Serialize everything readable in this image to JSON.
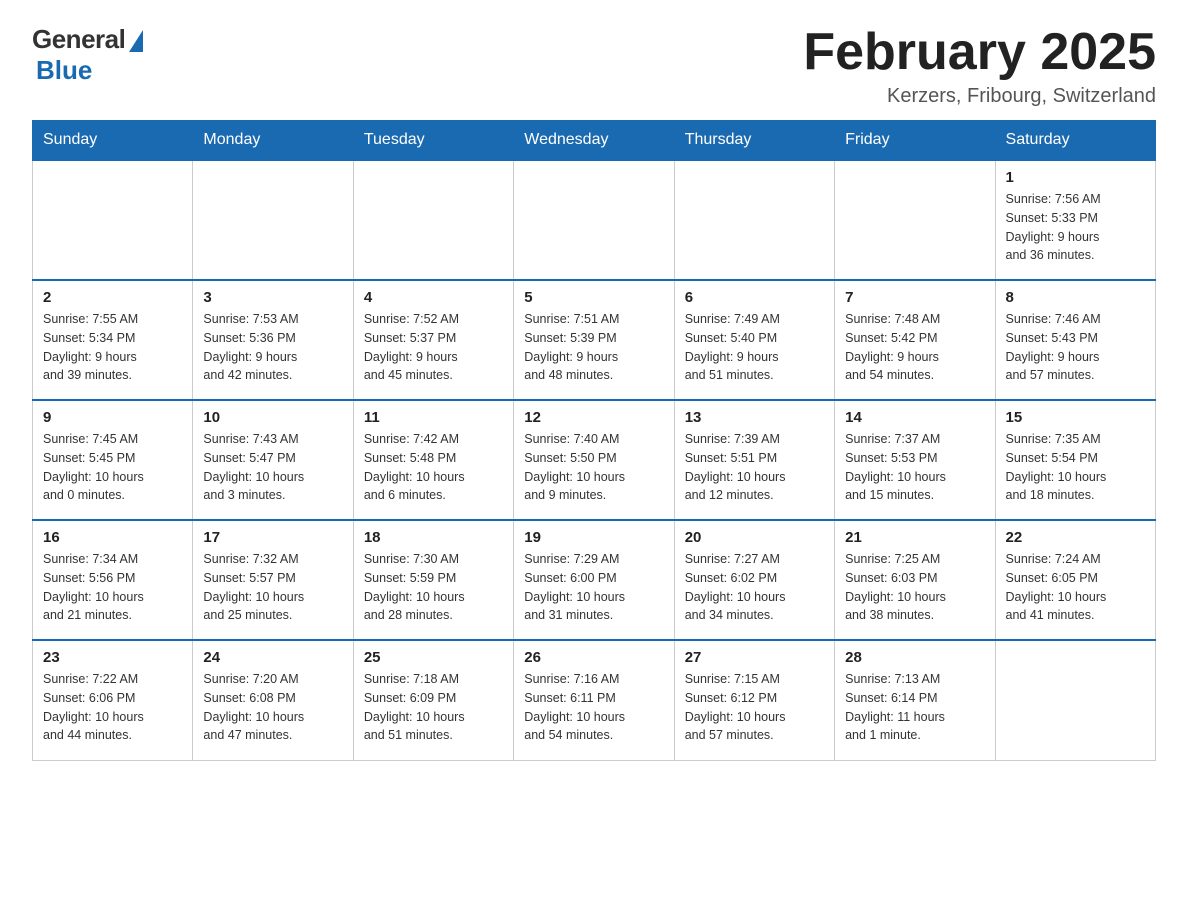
{
  "logo": {
    "general": "General",
    "blue": "Blue"
  },
  "header": {
    "month_title": "February 2025",
    "location": "Kerzers, Fribourg, Switzerland"
  },
  "weekdays": [
    "Sunday",
    "Monday",
    "Tuesday",
    "Wednesday",
    "Thursday",
    "Friday",
    "Saturday"
  ],
  "weeks": [
    {
      "days": [
        {
          "date": "",
          "info": ""
        },
        {
          "date": "",
          "info": ""
        },
        {
          "date": "",
          "info": ""
        },
        {
          "date": "",
          "info": ""
        },
        {
          "date": "",
          "info": ""
        },
        {
          "date": "",
          "info": ""
        },
        {
          "date": "1",
          "info": "Sunrise: 7:56 AM\nSunset: 5:33 PM\nDaylight: 9 hours\nand 36 minutes."
        }
      ]
    },
    {
      "days": [
        {
          "date": "2",
          "info": "Sunrise: 7:55 AM\nSunset: 5:34 PM\nDaylight: 9 hours\nand 39 minutes."
        },
        {
          "date": "3",
          "info": "Sunrise: 7:53 AM\nSunset: 5:36 PM\nDaylight: 9 hours\nand 42 minutes."
        },
        {
          "date": "4",
          "info": "Sunrise: 7:52 AM\nSunset: 5:37 PM\nDaylight: 9 hours\nand 45 minutes."
        },
        {
          "date": "5",
          "info": "Sunrise: 7:51 AM\nSunset: 5:39 PM\nDaylight: 9 hours\nand 48 minutes."
        },
        {
          "date": "6",
          "info": "Sunrise: 7:49 AM\nSunset: 5:40 PM\nDaylight: 9 hours\nand 51 minutes."
        },
        {
          "date": "7",
          "info": "Sunrise: 7:48 AM\nSunset: 5:42 PM\nDaylight: 9 hours\nand 54 minutes."
        },
        {
          "date": "8",
          "info": "Sunrise: 7:46 AM\nSunset: 5:43 PM\nDaylight: 9 hours\nand 57 minutes."
        }
      ]
    },
    {
      "days": [
        {
          "date": "9",
          "info": "Sunrise: 7:45 AM\nSunset: 5:45 PM\nDaylight: 10 hours\nand 0 minutes."
        },
        {
          "date": "10",
          "info": "Sunrise: 7:43 AM\nSunset: 5:47 PM\nDaylight: 10 hours\nand 3 minutes."
        },
        {
          "date": "11",
          "info": "Sunrise: 7:42 AM\nSunset: 5:48 PM\nDaylight: 10 hours\nand 6 minutes."
        },
        {
          "date": "12",
          "info": "Sunrise: 7:40 AM\nSunset: 5:50 PM\nDaylight: 10 hours\nand 9 minutes."
        },
        {
          "date": "13",
          "info": "Sunrise: 7:39 AM\nSunset: 5:51 PM\nDaylight: 10 hours\nand 12 minutes."
        },
        {
          "date": "14",
          "info": "Sunrise: 7:37 AM\nSunset: 5:53 PM\nDaylight: 10 hours\nand 15 minutes."
        },
        {
          "date": "15",
          "info": "Sunrise: 7:35 AM\nSunset: 5:54 PM\nDaylight: 10 hours\nand 18 minutes."
        }
      ]
    },
    {
      "days": [
        {
          "date": "16",
          "info": "Sunrise: 7:34 AM\nSunset: 5:56 PM\nDaylight: 10 hours\nand 21 minutes."
        },
        {
          "date": "17",
          "info": "Sunrise: 7:32 AM\nSunset: 5:57 PM\nDaylight: 10 hours\nand 25 minutes."
        },
        {
          "date": "18",
          "info": "Sunrise: 7:30 AM\nSunset: 5:59 PM\nDaylight: 10 hours\nand 28 minutes."
        },
        {
          "date": "19",
          "info": "Sunrise: 7:29 AM\nSunset: 6:00 PM\nDaylight: 10 hours\nand 31 minutes."
        },
        {
          "date": "20",
          "info": "Sunrise: 7:27 AM\nSunset: 6:02 PM\nDaylight: 10 hours\nand 34 minutes."
        },
        {
          "date": "21",
          "info": "Sunrise: 7:25 AM\nSunset: 6:03 PM\nDaylight: 10 hours\nand 38 minutes."
        },
        {
          "date": "22",
          "info": "Sunrise: 7:24 AM\nSunset: 6:05 PM\nDaylight: 10 hours\nand 41 minutes."
        }
      ]
    },
    {
      "days": [
        {
          "date": "23",
          "info": "Sunrise: 7:22 AM\nSunset: 6:06 PM\nDaylight: 10 hours\nand 44 minutes."
        },
        {
          "date": "24",
          "info": "Sunrise: 7:20 AM\nSunset: 6:08 PM\nDaylight: 10 hours\nand 47 minutes."
        },
        {
          "date": "25",
          "info": "Sunrise: 7:18 AM\nSunset: 6:09 PM\nDaylight: 10 hours\nand 51 minutes."
        },
        {
          "date": "26",
          "info": "Sunrise: 7:16 AM\nSunset: 6:11 PM\nDaylight: 10 hours\nand 54 minutes."
        },
        {
          "date": "27",
          "info": "Sunrise: 7:15 AM\nSunset: 6:12 PM\nDaylight: 10 hours\nand 57 minutes."
        },
        {
          "date": "28",
          "info": "Sunrise: 7:13 AM\nSunset: 6:14 PM\nDaylight: 11 hours\nand 1 minute."
        },
        {
          "date": "",
          "info": ""
        }
      ]
    }
  ]
}
